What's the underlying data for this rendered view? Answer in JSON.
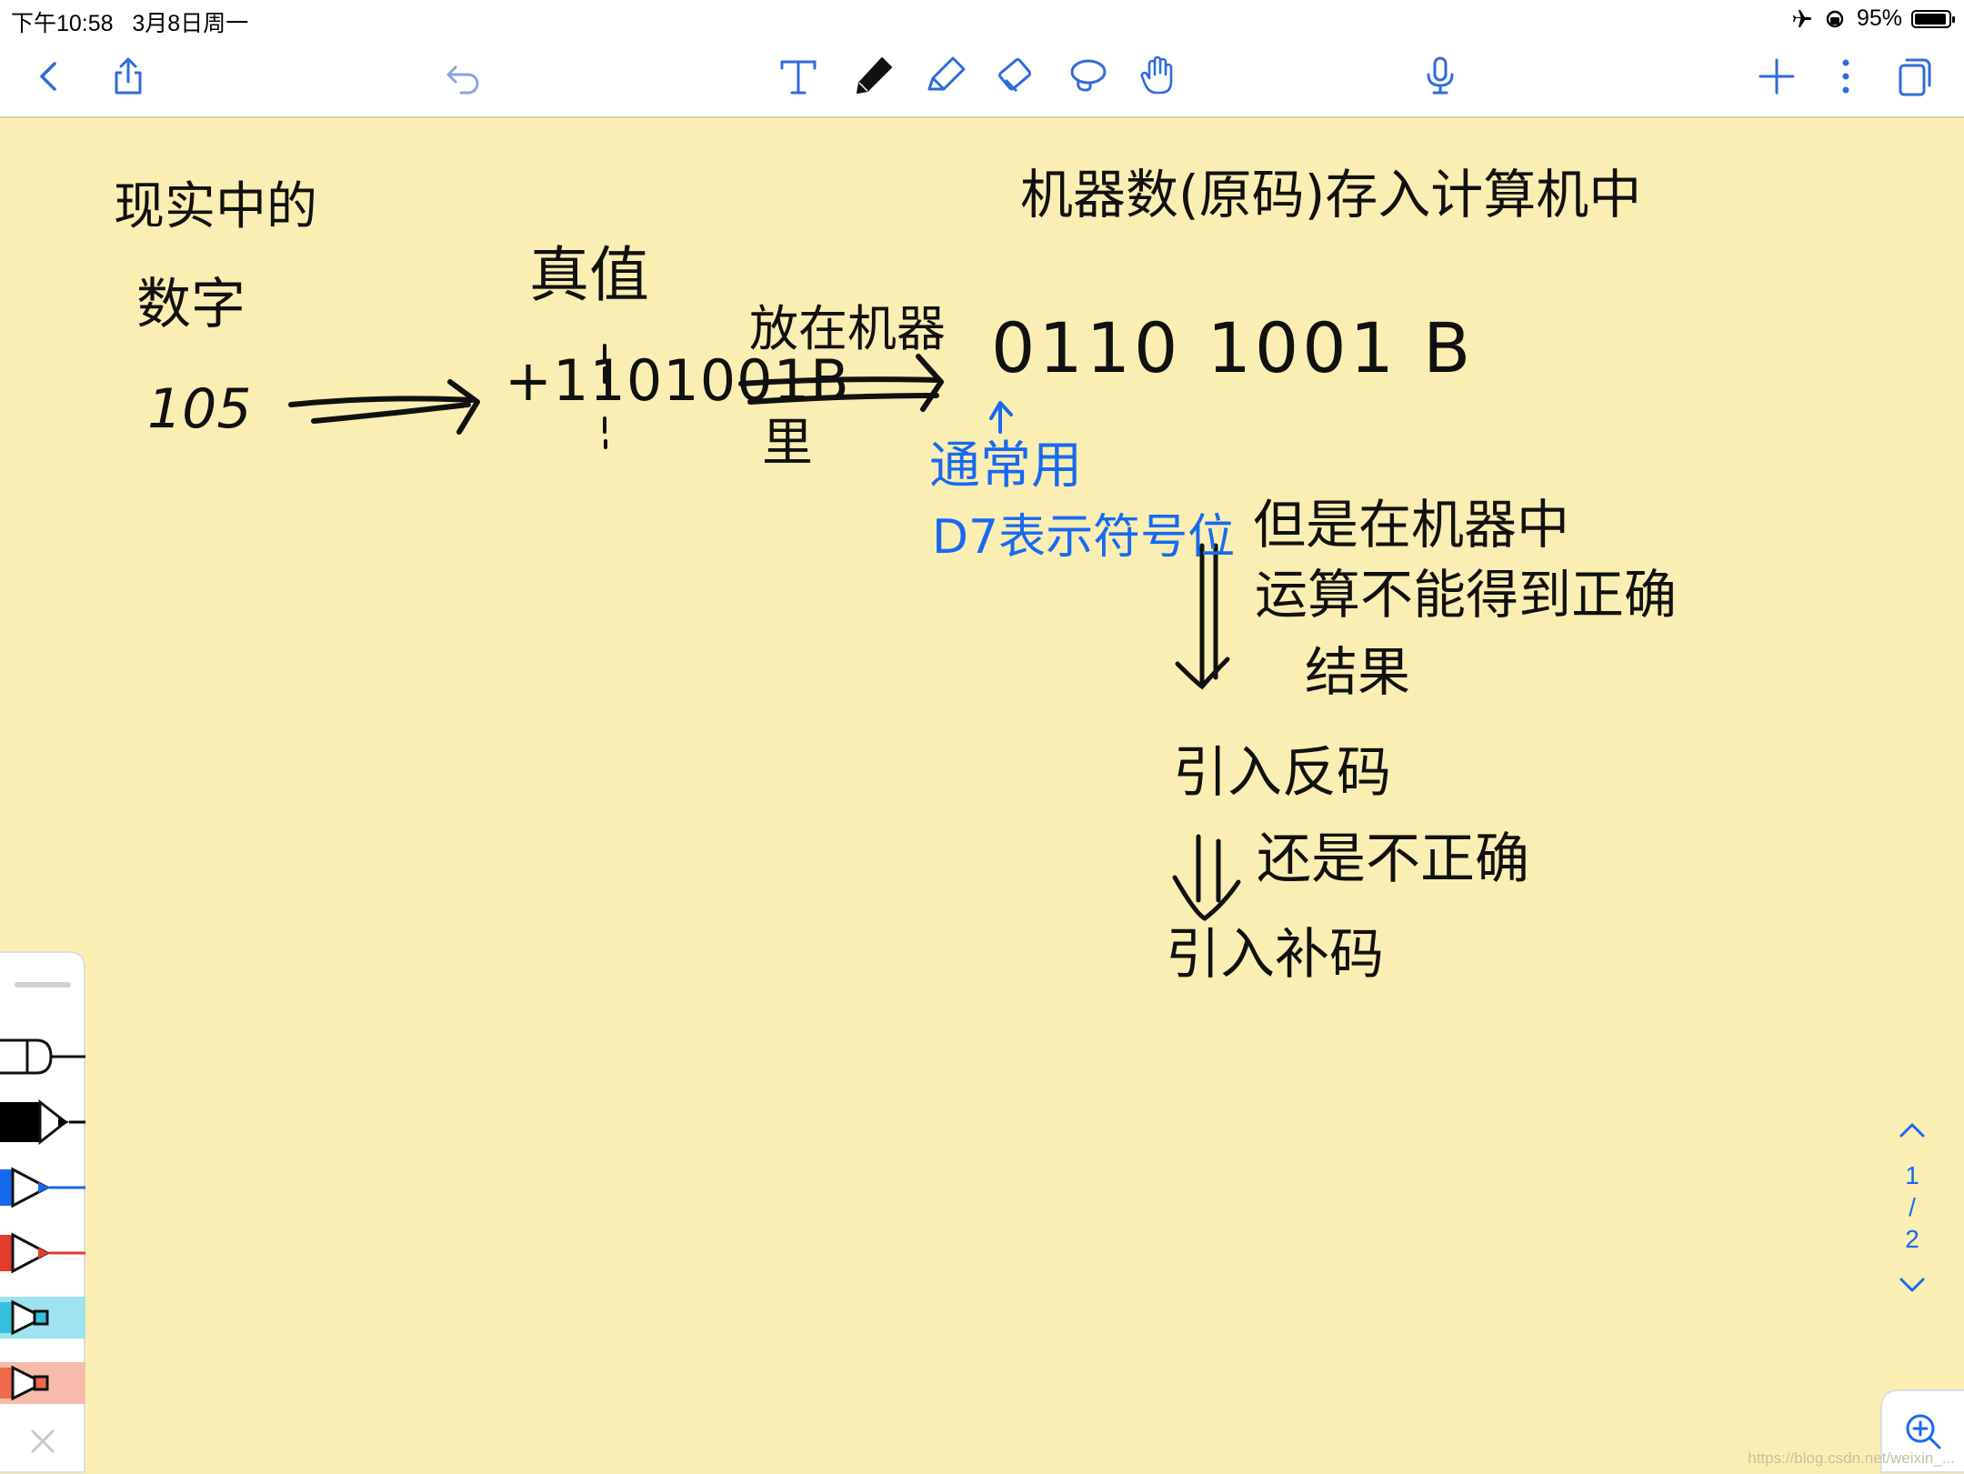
{
  "status_bar": {
    "time": "下午10:58",
    "date": "3月8日周一",
    "battery_percent": "95%",
    "battery_level": 0.95
  },
  "toolbar": {
    "left": [
      {
        "name": "back-chevron-icon"
      },
      {
        "name": "share-icon"
      },
      {
        "name": "undo-icon"
      }
    ],
    "tools": [
      {
        "name": "text-tool-icon"
      },
      {
        "name": "pen-tool-icon",
        "selected": true
      },
      {
        "name": "highlighter-tool-icon"
      },
      {
        "name": "eraser-tool-icon"
      },
      {
        "name": "lasso-tool-icon"
      },
      {
        "name": "hand-tool-icon"
      }
    ],
    "right": [
      {
        "name": "microphone-icon"
      },
      {
        "name": "add-icon"
      },
      {
        "name": "more-icon"
      },
      {
        "name": "pages-icon"
      }
    ],
    "accent_color": "#2f6bdc"
  },
  "notes": {
    "real_number_label": "现实中的",
    "number_label": "数字",
    "decimal_value": "105",
    "true_value_label": "真值",
    "true_value": "+1101001B",
    "put_in_machine": "放在机器",
    "inside": "里",
    "machine_number_caption": "机器数(原码)存入计算机中",
    "machine_number": "0110 1001 B",
    "blue_note_1": "通常用",
    "blue_note_2": "D7表示符号位",
    "problem_1": "但是在机器中",
    "problem_2": "运算不能得到正确",
    "problem_3": "结果",
    "introduce_ones_complement": "引入反码",
    "still_incorrect": "还是不正确",
    "introduce_twos_complement": "引入补码"
  },
  "ink_colors": {
    "black": "#111111",
    "blue": "#1769f0",
    "paper": "#fbeeb2"
  },
  "palette": {
    "pens": [
      {
        "name": "pen-white",
        "color": "#ffffff"
      },
      {
        "name": "pen-black",
        "color": "#000000",
        "selected": true
      },
      {
        "name": "pen-blue",
        "color": "#1769f0"
      },
      {
        "name": "pen-red",
        "color": "#e53b2a"
      },
      {
        "name": "highlighter-cyan",
        "color": "#34c1dd"
      },
      {
        "name": "highlighter-salmon",
        "color": "#ef6a4b"
      }
    ]
  },
  "pager": {
    "current": "1",
    "separator": "/",
    "total": "2"
  },
  "watermark": "https://blog.csdn.net/weixin_..."
}
